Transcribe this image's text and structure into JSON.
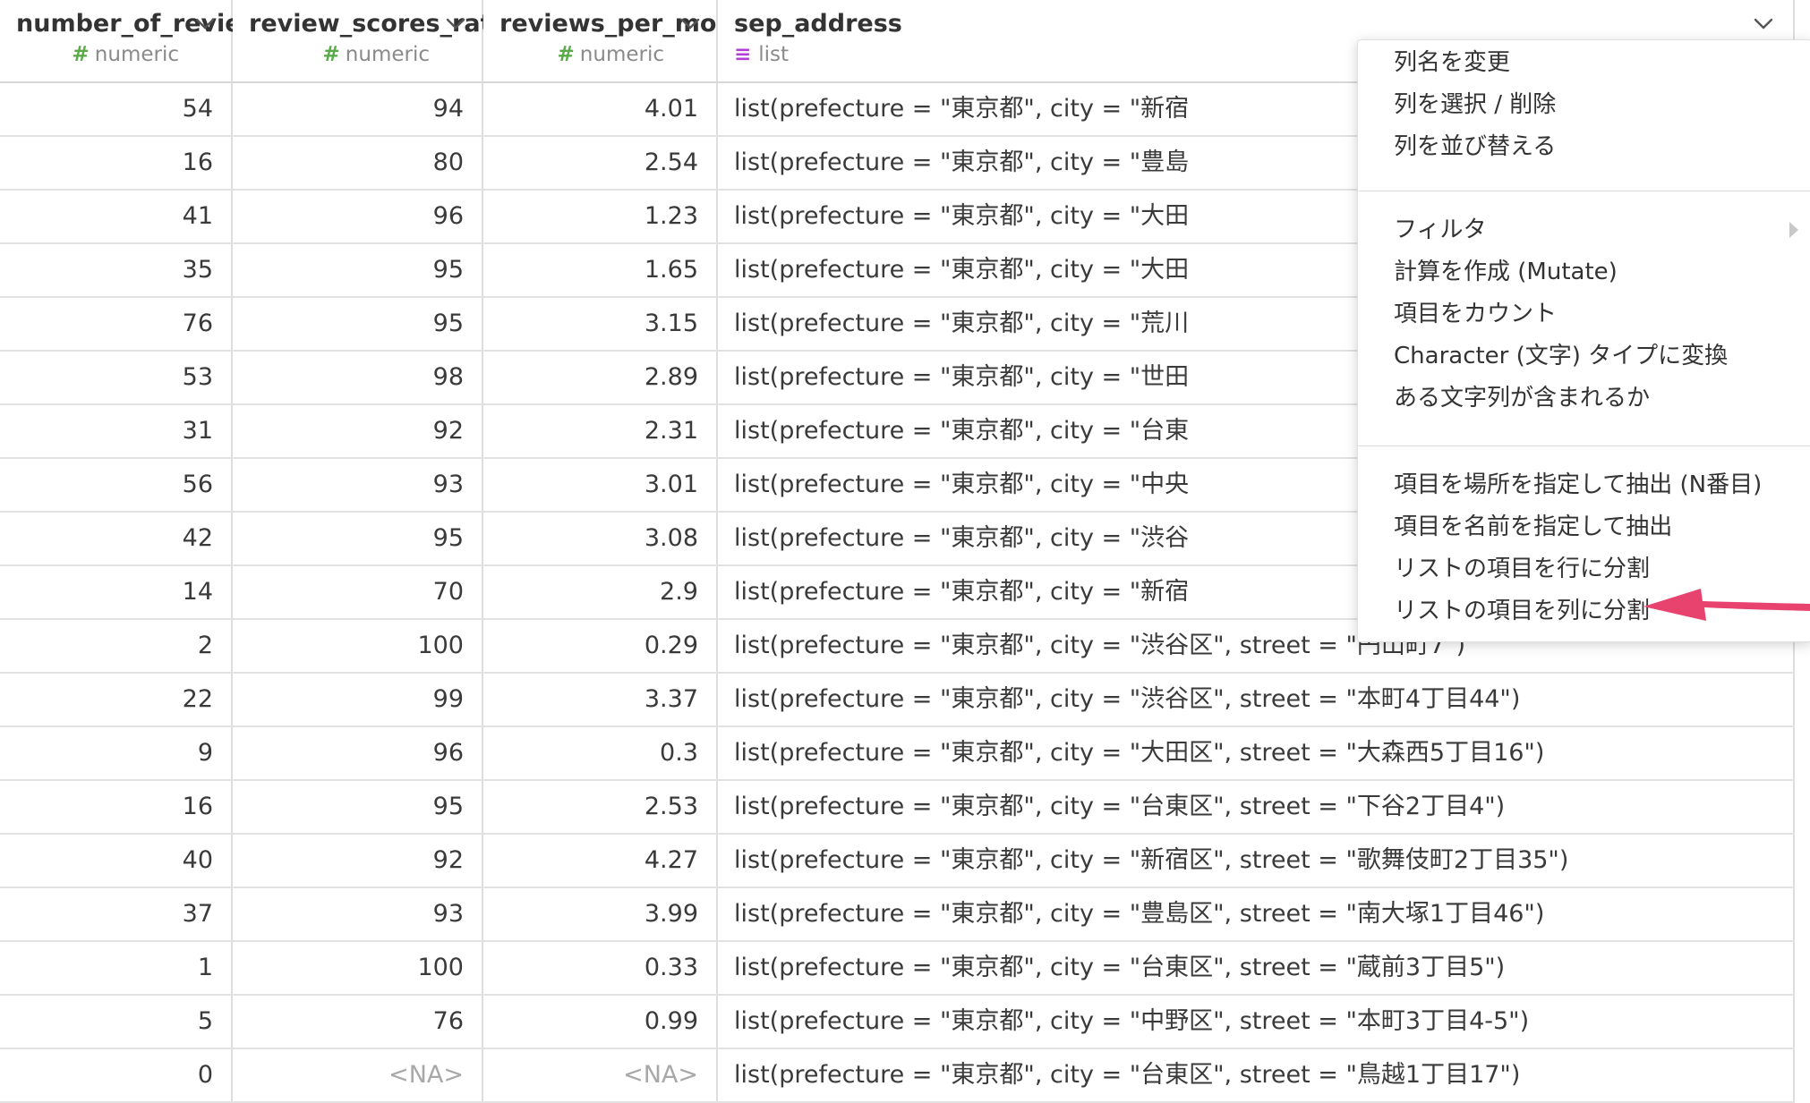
{
  "columns": [
    {
      "name": "number_of_reviews",
      "type_icon": "#",
      "type": "numeric"
    },
    {
      "name": "review_scores_rating",
      "type_icon": "#",
      "type": "numeric"
    },
    {
      "name": "reviews_per_month",
      "type_icon": "#",
      "type": "numeric"
    },
    {
      "name": "sep_address",
      "type_icon": "≡",
      "type": "list"
    }
  ],
  "rows": [
    [
      "54",
      "94",
      "4.01",
      "list(prefecture = \"東京都\", city = \"新宿"
    ],
    [
      "16",
      "80",
      "2.54",
      "list(prefecture = \"東京都\", city = \"豊島"
    ],
    [
      "41",
      "96",
      "1.23",
      "list(prefecture = \"東京都\", city = \"大田"
    ],
    [
      "35",
      "95",
      "1.65",
      "list(prefecture = \"東京都\", city = \"大田"
    ],
    [
      "76",
      "95",
      "3.15",
      "list(prefecture = \"東京都\", city = \"荒川"
    ],
    [
      "53",
      "98",
      "2.89",
      "list(prefecture = \"東京都\", city = \"世田"
    ],
    [
      "31",
      "92",
      "2.31",
      "list(prefecture = \"東京都\", city = \"台東"
    ],
    [
      "56",
      "93",
      "3.01",
      "list(prefecture = \"東京都\", city = \"中央"
    ],
    [
      "42",
      "95",
      "3.08",
      "list(prefecture = \"東京都\", city = \"渋谷"
    ],
    [
      "14",
      "70",
      "2.9",
      "list(prefecture = \"東京都\", city = \"新宿"
    ],
    [
      "2",
      "100",
      "0.29",
      "list(prefecture = \"東京都\", city = \"渋谷区\", street = \"円山町7\")"
    ],
    [
      "22",
      "99",
      "3.37",
      "list(prefecture = \"東京都\", city = \"渋谷区\", street = \"本町4丁目44\")"
    ],
    [
      "9",
      "96",
      "0.3",
      "list(prefecture = \"東京都\", city = \"大田区\", street = \"大森西5丁目16\")"
    ],
    [
      "16",
      "95",
      "2.53",
      "list(prefecture = \"東京都\", city = \"台東区\", street = \"下谷2丁目4\")"
    ],
    [
      "40",
      "92",
      "4.27",
      "list(prefecture = \"東京都\", city = \"新宿区\", street = \"歌舞伎町2丁目35\")"
    ],
    [
      "37",
      "93",
      "3.99",
      "list(prefecture = \"東京都\", city = \"豊島区\", street = \"南大塚1丁目46\")"
    ],
    [
      "1",
      "100",
      "0.33",
      "list(prefecture = \"東京都\", city = \"台東区\", street = \"蔵前3丁目5\")"
    ],
    [
      "5",
      "76",
      "0.99",
      "list(prefecture = \"東京都\", city = \"中野区\", street = \"本町3丁目4-5\")"
    ],
    [
      "0",
      "<NA>",
      "<NA>",
      "list(prefecture = \"東京都\", city = \"台東区\", street = \"鳥越1丁目17\")"
    ]
  ],
  "menu": {
    "groups": [
      [
        "列名を変更",
        "列を選択 / 削除",
        "列を並び替える"
      ],
      [
        "フィルタ",
        "計算を作成 (Mutate)",
        "項目をカウント",
        "Character (文字) タイプに変換",
        "ある文字列が含まれるか"
      ],
      [
        "項目を場所を指定して抽出 (N番目)",
        "項目を名前を指定して抽出",
        "リストの項目を行に分割",
        "リストの項目を列に分割"
      ]
    ],
    "submenu_item": "フィルタ",
    "highlighted_item": "リストの項目を列に分割"
  },
  "colors": {
    "numeric_icon": "#5aaa4a",
    "list_icon": "#b13fd5",
    "arrow": "#e8436e"
  },
  "icons": {
    "column_menu": "chevron-down-icon",
    "submenu": "chevron-right-icon",
    "annotation": "arrow-pointer-icon"
  }
}
